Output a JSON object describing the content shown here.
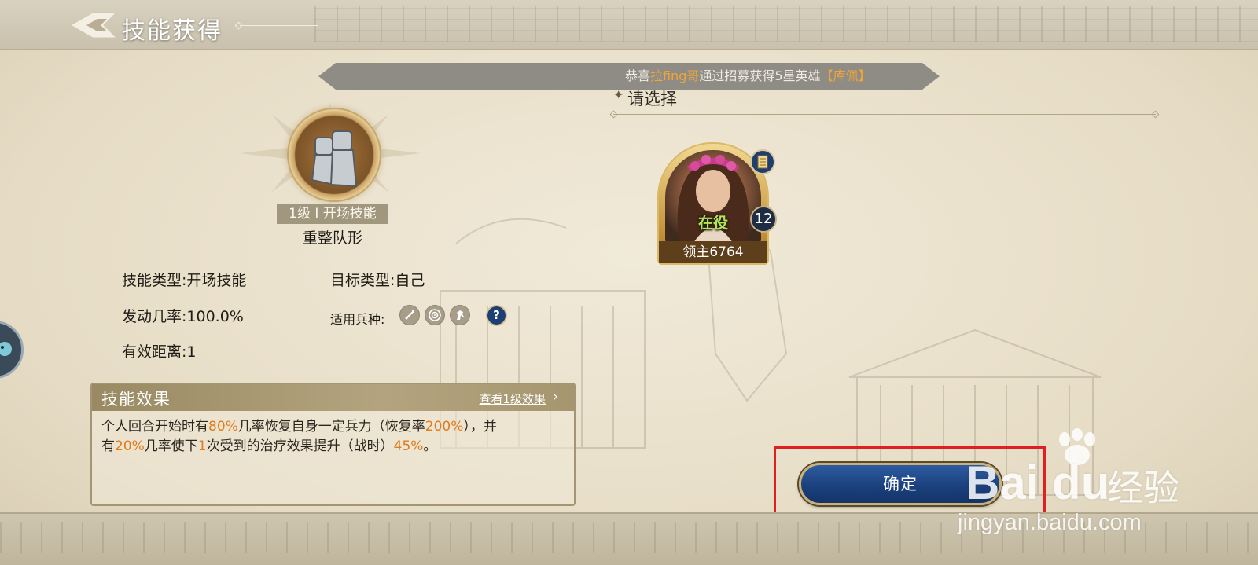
{
  "header": {
    "title": "技能获得"
  },
  "announcement": {
    "prefix": "恭喜",
    "player": "拉fing哥",
    "middle": "通过招募获得5星英雄",
    "hero": "【库佩】"
  },
  "skill": {
    "level_label": "1级 I 开场技能",
    "name": "重整队形",
    "type": "技能类型:开场技能",
    "target": "目标类型:自己",
    "rate": "发动几率:100.0%",
    "units_label": "适用兵种:",
    "range": "有效距离:1"
  },
  "effect": {
    "title": "技能效果",
    "link": "查看1级效果",
    "line1_a": "个人回合开始时有",
    "line1_b": "80%",
    "line1_c": "几率恢复自身一定兵力（恢复率",
    "line1_d": "200%",
    "line1_e": "），并",
    "line2_a": "有",
    "line2_b": "20%",
    "line2_c": "几率使下",
    "line2_d": "1",
    "line2_e": "次受到的治疗效果提升（战时）",
    "line2_f": "45%",
    "line2_g": "。"
  },
  "choose": {
    "title": "请选择"
  },
  "hero_card": {
    "status": "在役",
    "owner": "领主6764",
    "level": "12"
  },
  "confirm": {
    "label": "确定"
  },
  "watermark": {
    "brand": "Bai du",
    "brand_cn": "经验",
    "url": "jingyan.baidu.com"
  },
  "colors": {
    "accent_orange": "#e07b1e",
    "announce_highlight": "#f2a436",
    "confirm_blue": "#1a3f7a",
    "status_green": "#b6e35a",
    "highlight_box": "#e02020"
  },
  "icons": [
    "back-logo-icon",
    "sword-unit-icon",
    "target-unit-icon",
    "horse-unit-icon",
    "help-icon",
    "document-icon"
  ]
}
